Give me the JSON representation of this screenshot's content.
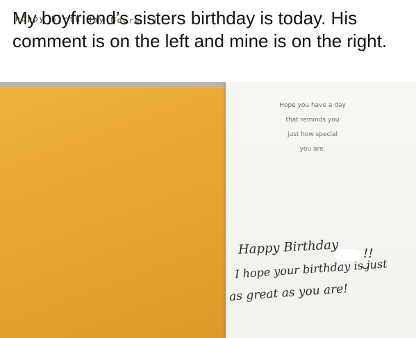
{
  "caption": "My boyfriend’s sisters birthday is today. His comment is on the left and mine is on the right.",
  "card": {
    "left_note": "hoppy birth day Moore :)",
    "printed_lines": [
      "Hope you have a day",
      "that reminds you",
      "just how special",
      "you are."
    ],
    "handwritten": {
      "line1": "Happy Birthday",
      "line1_end": "!!",
      "line2": "I hope your birthday is just",
      "line3": "as great as you are!"
    }
  },
  "colors": {
    "envelope_orange": "#e9a531",
    "card_white": "#f5f4f0"
  }
}
